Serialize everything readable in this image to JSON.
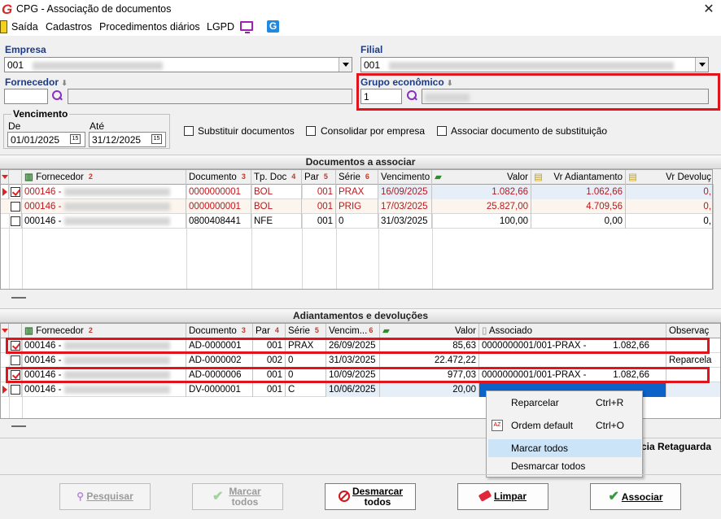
{
  "window": {
    "title": "CPG - Associação de documentos",
    "close_glyph": "✕"
  },
  "menu": {
    "items": [
      "Saída",
      "Cadastros",
      "Procedimentos diários",
      "LGPD"
    ]
  },
  "filters": {
    "empresa_label": "Empresa",
    "empresa_value": "001",
    "filial_label": "Filial",
    "filial_value": "001",
    "fornecedor_label": "Fornecedor",
    "grupo_label": "Grupo econômico",
    "grupo_value": "1",
    "vencimento_label": "Vencimento",
    "de_label": "De",
    "de_value": "01/01/2025",
    "ate_label": "Até",
    "ate_value": "31/12/2025",
    "cal_glyph": "15",
    "opt_substituir": "Substituir documentos",
    "opt_consolidar": "Consolidar por empresa",
    "opt_associar_sub": "Associar documento de substituição"
  },
  "docs": {
    "section_title": "Documentos a associar",
    "headers": {
      "fornecedor": "Fornecedor",
      "fornecedor_n": "2",
      "documento": "Documento",
      "documento_n": "3",
      "tpdoc": "Tp. Doc",
      "tpdoc_n": "4",
      "par": "Par",
      "par_n": "5",
      "serie": "Série",
      "serie_n": "6",
      "vencimento": "Vencimento",
      "valor": "Valor",
      "vradiant": "Vr Adiantamento",
      "vrdevol": "Vr Devoluç"
    },
    "rows": [
      {
        "fornecedor": "000146 -",
        "documento": "0000000001",
        "tpdoc": "BOL",
        "par": "001",
        "serie": "PRAX",
        "vencimento": "16/09/2025",
        "valor": "1.082,66",
        "vradiant": "1.062,66",
        "vrdevol": "0,"
      },
      {
        "fornecedor": "000146 -",
        "documento": "0000000001",
        "tpdoc": "BOL",
        "par": "001",
        "serie": "PRIG",
        "vencimento": "17/03/2025",
        "valor": "25.827,00",
        "vradiant": "4.709,56",
        "vrdevol": "0,"
      },
      {
        "fornecedor": "000146 -",
        "documento": "0800408441",
        "tpdoc": "NFE",
        "par": "001",
        "serie": "0",
        "vencimento": "31/03/2025",
        "valor": "100,00",
        "vradiant": "0,00",
        "vrdevol": "0,"
      }
    ]
  },
  "adiant": {
    "section_title": "Adiantamentos e devoluções",
    "headers": {
      "fornecedor": "Fornecedor",
      "fornecedor_n": "2",
      "documento": "Documento",
      "documento_n": "3",
      "par": "Par",
      "par_n": "4",
      "serie": "Série",
      "serie_n": "5",
      "vencimento": "Vencim...",
      "vencimento_n": "6",
      "valor": "Valor",
      "associado": "Associado",
      "observacao": "Observaç"
    },
    "rows": [
      {
        "fornecedor": "000146 -",
        "documento": "AD-0000001",
        "par": "001",
        "serie": "PRAX",
        "vencimento": "26/09/2025",
        "valor": "85,63",
        "associado": "0000000001/001-PRAX -",
        "assoc_valor": "1.082,66",
        "obs": ""
      },
      {
        "fornecedor": "000146 -",
        "documento": "AD-0000002",
        "par": "002",
        "serie": "0",
        "vencimento": "31/03/2025",
        "valor": "22.472,22",
        "associado": "",
        "assoc_valor": "",
        "obs": "Reparcela"
      },
      {
        "fornecedor": "000146 -",
        "documento": "AD-0000006",
        "par": "001",
        "serie": "0",
        "vencimento": "10/09/2025",
        "valor": "977,03",
        "associado": "0000000001/001-PRAX -",
        "assoc_valor": "1.082,66",
        "obs": ""
      },
      {
        "fornecedor": "000146 -",
        "documento": "DV-0000001",
        "par": "001",
        "serie": "C",
        "vencimento": "10/06/2025",
        "valor": "20,00",
        "associado": "",
        "assoc_valor": "",
        "obs": ""
      }
    ]
  },
  "context_menu": {
    "items": [
      {
        "label": "Reparcelar",
        "shortcut": "Ctrl+R"
      },
      {
        "label": "Ordem default",
        "shortcut": "Ctrl+O"
      },
      {
        "label": "Marcar todos",
        "shortcut": ""
      },
      {
        "label": "Desmarcar todos",
        "shortcut": ""
      }
    ]
  },
  "status": {
    "right_text": "cia Retaguarda"
  },
  "buttons": {
    "pesquisar": "Pesquisar",
    "marcar_l1": "Marcar",
    "marcar_l2": "todos",
    "desmarcar_l1": "Desmarcar",
    "desmarcar_l2": "todos",
    "limpar": "Limpar",
    "associar": "Associar"
  }
}
